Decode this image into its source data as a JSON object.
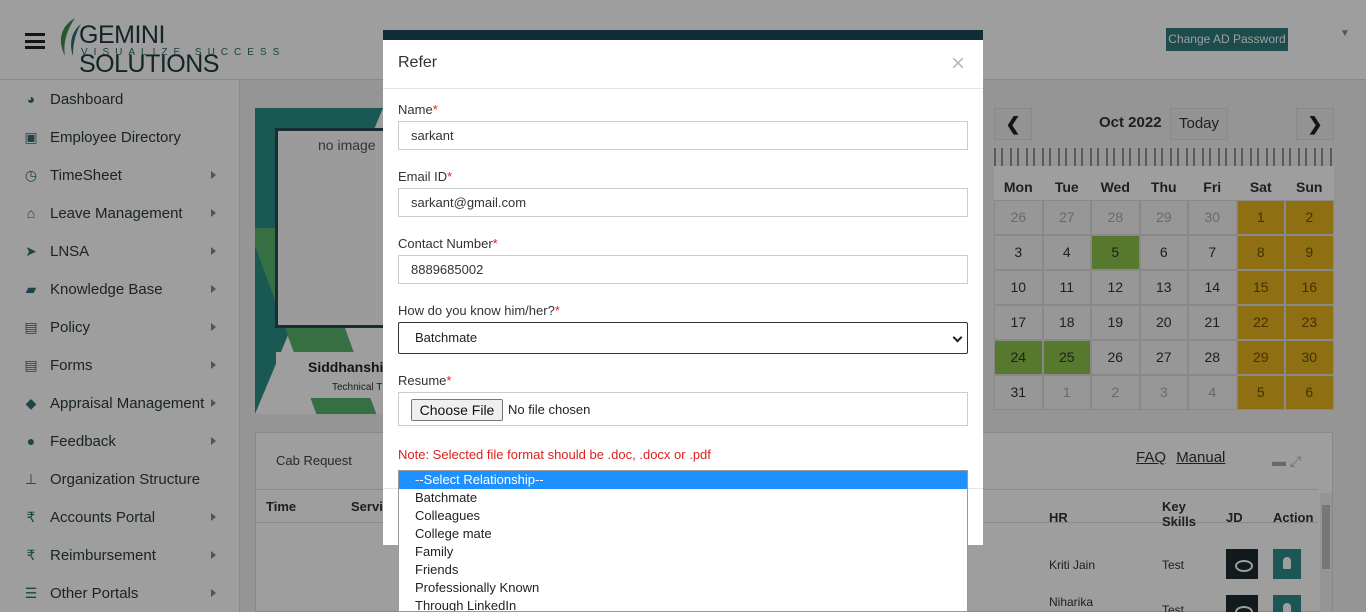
{
  "header": {
    "logo_name": "GEMINI SOLUTIONS",
    "logo_tagline": "VISUALIZE SUCCESS",
    "change_password": "Change AD Password"
  },
  "sidebar": {
    "items": [
      {
        "label": "Dashboard",
        "icon": "dashboard-icon",
        "arrow": false
      },
      {
        "label": "Employee Directory",
        "icon": "id-card-icon",
        "arrow": false
      },
      {
        "label": "TimeSheet",
        "icon": "clock-icon",
        "arrow": true
      },
      {
        "label": "Leave Management",
        "icon": "home-icon",
        "arrow": true
      },
      {
        "label": "LNSA",
        "icon": "paper-plane-icon",
        "arrow": true
      },
      {
        "label": "Knowledge Base",
        "icon": "folder-icon",
        "arrow": true
      },
      {
        "label": "Policy",
        "icon": "document-icon",
        "arrow": true
      },
      {
        "label": "Forms",
        "icon": "form-icon",
        "arrow": true
      },
      {
        "label": "Appraisal Management",
        "icon": "graduation-cap-icon",
        "arrow": true
      },
      {
        "label": "Feedback",
        "icon": "chat-icon",
        "arrow": true
      },
      {
        "label": "Organization Structure",
        "icon": "sitemap-icon",
        "arrow": false
      },
      {
        "label": "Accounts Portal",
        "icon": "rupee-icon",
        "arrow": true
      },
      {
        "label": "Reimbursement",
        "icon": "rupee-icon",
        "arrow": true
      },
      {
        "label": "Other Portals",
        "icon": "list-icon",
        "arrow": true
      }
    ]
  },
  "profile": {
    "image_alt": "no image",
    "name": "Siddhanshi",
    "role": "Technical T"
  },
  "calendar": {
    "title": "Oct 2022",
    "today": "Today",
    "prev": "❮",
    "next": "❯",
    "weekdays": [
      "Mon",
      "Tue",
      "Wed",
      "Thu",
      "Fri",
      "Sat",
      "Sun"
    ],
    "weeks": [
      [
        "26",
        "27",
        "28",
        "29",
        "30",
        "1",
        "2"
      ],
      [
        "3",
        "4",
        "5",
        "6",
        "7",
        "8",
        "9"
      ],
      [
        "10",
        "11",
        "12",
        "13",
        "14",
        "15",
        "16"
      ],
      [
        "17",
        "18",
        "19",
        "20",
        "21",
        "22",
        "23"
      ],
      [
        "24",
        "25",
        "26",
        "27",
        "28",
        "29",
        "30"
      ],
      [
        "31",
        "1",
        "2",
        "3",
        "4",
        "5",
        "6"
      ]
    ],
    "colors": {
      "weekend": "#e6b41e",
      "holiday": "#8bc34a"
    }
  },
  "panel": {
    "tab_label": "Cab Request",
    "links": [
      "FAQ",
      "Manual"
    ],
    "headers": [
      "Time",
      "Servi",
      "HR",
      "Key Skills",
      "JD",
      "Action"
    ],
    "rows": [
      {
        "hr": "Kriti Jain",
        "skills": "Test"
      },
      {
        "hr": "Niharika",
        "skills": "Test"
      }
    ]
  },
  "modal": {
    "title": "Refer",
    "close": "×",
    "fields": {
      "name_label": "Name",
      "name_value": "sarkant",
      "email_label": "Email ID",
      "email_value": "sarkant@gmail.com",
      "contact_label": "Contact Number",
      "contact_value": "8889685002",
      "relation_label": "How do you know him/her?",
      "relation_value": "Batchmate",
      "resume_label": "Resume",
      "choose_file": "Choose File",
      "no_file": "No file chosen"
    },
    "required_mark": "*",
    "note": "Note: Selected file format should be .doc, .docx or .pdf"
  },
  "dropdown": {
    "options": [
      "--Select Relationship--",
      "Batchmate",
      "Colleagues",
      "College mate",
      "Family",
      "Friends",
      "Professionally Known",
      "Through LinkedIn"
    ]
  }
}
